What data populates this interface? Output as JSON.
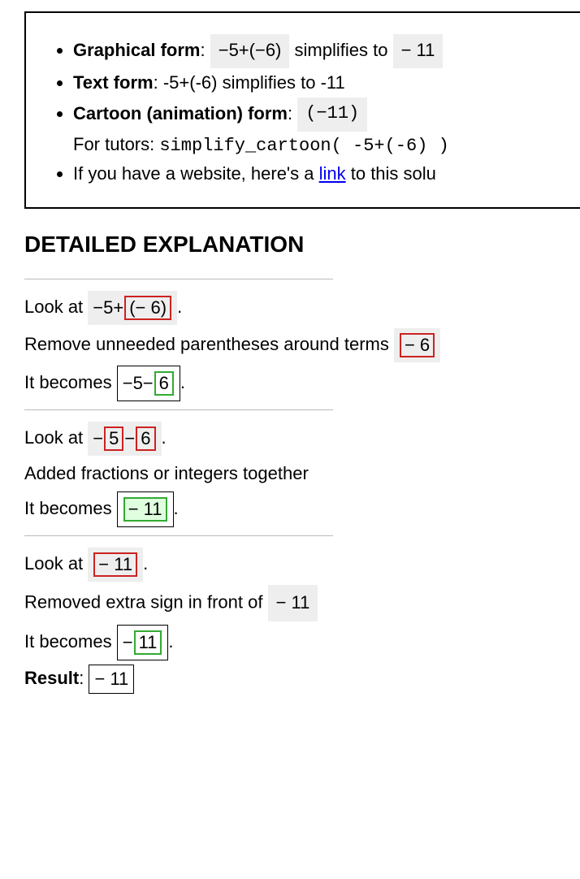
{
  "summary": {
    "graphical_label": "Graphical form",
    "graphical_expr": "−5+(−6)",
    "simplifies_to": " simplifies to ",
    "graphical_result": "− 11",
    "text_label": "Text form",
    "text_body": ": -5+(-6) simplifies to -11",
    "cartoon_label": "Cartoon (animation) form",
    "cartoon_expr": "(−11)",
    "for_tutors_label": "For tutors: ",
    "for_tutors_code": "simplify_cartoon( -5+(-6) )",
    "website_prefix": "If you have a website, here's a ",
    "link_text": "link",
    "website_suffix": " to this solu"
  },
  "section_heading": "DETAILED EXPLANATION",
  "labels": {
    "look_at": "Look at ",
    "it_becomes": "It becomes ",
    "result": "Result"
  },
  "step1": {
    "expr_pre": "−5+",
    "expr_hi": "(− 6)",
    "explain": "Remove unneeded parentheses around terms ",
    "explain_chip": "− 6",
    "becomes_pre": "−5−",
    "becomes_hi": "6"
  },
  "step2": {
    "expr_pre1": "−",
    "expr_hi1": "5",
    "expr_mid": "−",
    "expr_hi2": "6",
    "explain": "Added fractions or integers together",
    "becomes_hi": "− 11"
  },
  "step3": {
    "expr_hi": "− 11",
    "explain": "Removed extra sign in front of ",
    "explain_chip": "− 11",
    "becomes_pre": "−",
    "becomes_hi": "11"
  },
  "result_chip": "− 11"
}
